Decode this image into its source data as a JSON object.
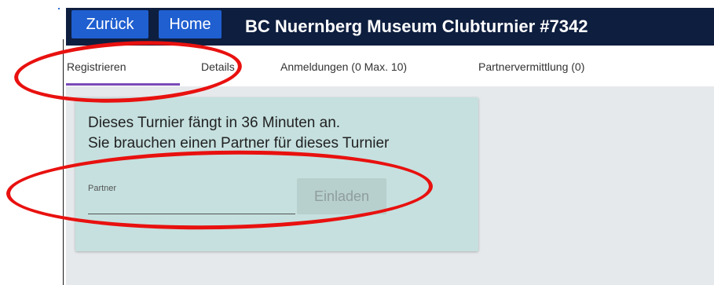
{
  "header": {
    "back_label": "Zurück",
    "home_label": "Home",
    "title": "BC Nuernberg Museum Clubturnier #7342"
  },
  "tabs": [
    {
      "label": "Registrieren",
      "active": true
    },
    {
      "label": "Details",
      "active": false
    },
    {
      "label": "Anmeldungen (0 Max. 10)",
      "active": false
    },
    {
      "label": "Partnervermittlung (0)",
      "active": false
    }
  ],
  "card": {
    "line1": "Dieses Turnier fängt in 36 Minuten an.",
    "line2": "Sie brauchen einen Partner für dieses Turnier",
    "partner_label": "Partner",
    "partner_value": "",
    "invite_label": "Einladen"
  },
  "colors": {
    "header_bg": "#0e1e3f",
    "button_blue": "#1f5fd0",
    "tab_accent": "#7b4bb7",
    "card_bg": "#c5e0df",
    "annotation_red": "#e8110f"
  }
}
